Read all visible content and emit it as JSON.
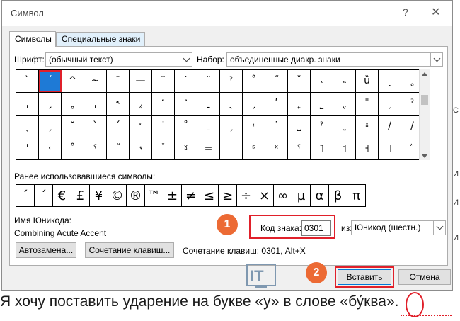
{
  "dialog": {
    "title": "Символ",
    "help_glyph": "?",
    "close_glyph": "✕"
  },
  "tabs": [
    {
      "label": "Символы",
      "active": true
    },
    {
      "label": "Специальные знаки",
      "active": false
    }
  ],
  "font": {
    "label": "Шрифт:",
    "value": "(обычный текст)"
  },
  "subset": {
    "label": "Набор:",
    "value": "объединенные диакр. знаки"
  },
  "grid": {
    "selected_row": 0,
    "selected_col": 1,
    "rows": [
      [
        "ˋ",
        "ˊ",
        "^",
        "~",
        "¯",
        "—",
        "˘",
        "˙",
        "¨",
        "ˀ",
        "˚",
        "˝",
        "ˇ",
        "˴",
        "˵",
        "ȕ",
        "ꞈ",
        "˳"
      ],
      [
        "ˌ",
        "ˏ",
        "˳",
        "ˌ",
        "˞",
        "⁁",
        "˹",
        "˺",
        "ˍ",
        "ˎ",
        "ˏ",
        "ʹ",
        "˿",
        "˾",
        "ˬ",
        "˭",
        "˯",
        "ˀ"
      ],
      [
        "ˎ",
        "ˏ",
        "˘",
        "ˋ",
        "ˊ",
        "ˑ",
        "˙",
        "˚",
        "ˍ",
        "ˏ",
        "˓",
        "˙",
        "˽",
        "ˀ",
        "˷",
        "ˠ",
        "/",
        "/"
      ],
      [
        "ˈ",
        "˓",
        "˚",
        "ˤ",
        "˝",
        "˞",
        "˟",
        "ˠ",
        "=",
        "ˡ",
        "ˢ",
        "ˣ",
        "ˤ",
        "˥",
        "˦",
        "˧",
        "˨",
        "ﾞ"
      ]
    ]
  },
  "recent": {
    "label": "Ранее использовавшиеся символы:",
    "symbols": [
      "ˊ",
      "ˊ",
      "€",
      "£",
      "¥",
      "©",
      "®",
      "™",
      "±",
      "≠",
      "≤",
      "≥",
      "÷",
      "×",
      "∞",
      "µ",
      "α",
      "β",
      "π"
    ]
  },
  "unicode_name": {
    "label": "Имя Юникода:",
    "value": "Combining Acute Accent"
  },
  "code": {
    "label": "Код знака:",
    "value": "0301"
  },
  "from": {
    "label": "из:",
    "value": "Юникод (шестн.)"
  },
  "buttons": {
    "autocorrect": "Автозамена...",
    "shortcut_key": "Сочетание клавиш...",
    "insert": "Вставить",
    "cancel": "Отмена"
  },
  "shortcut_text": "Сочетание клавиш: 0301, Alt+X",
  "badges": {
    "first": "1",
    "second": "2"
  },
  "watermark_text": "IT",
  "caption": "Я хочу поставить ударение на букве «у» в слове «бу́ква».",
  "colors": {
    "highlight": "#e0202a",
    "badge": "#ec6a34",
    "selected_cell": "#1e7ad6"
  }
}
